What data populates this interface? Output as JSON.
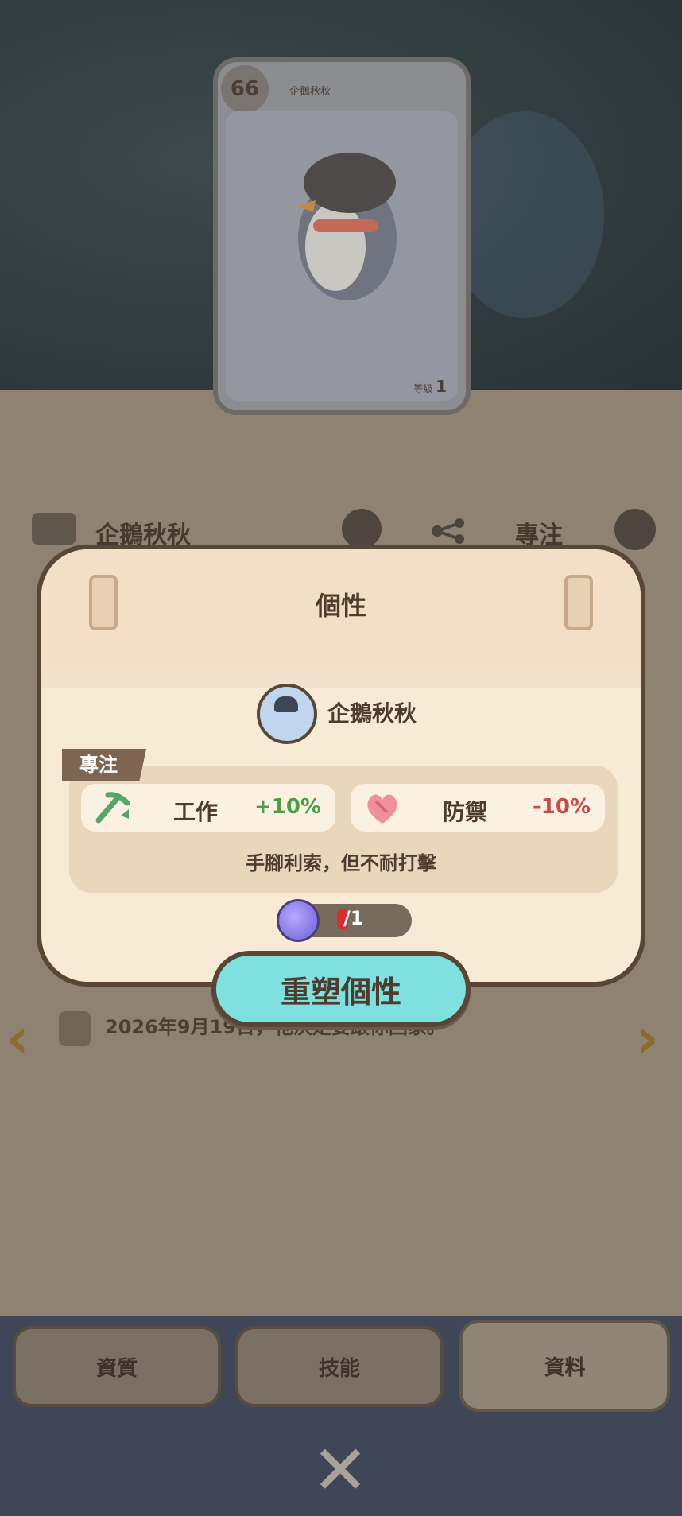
{
  "card": {
    "level_badge": "66",
    "name": "企鵝秋秋",
    "level_label": "等級",
    "level_value": "1"
  },
  "background_info": {
    "name": "企鵝秋秋",
    "focus_label": "專注",
    "note_text": "2026年9月19日，牠決定要跟你回家。"
  },
  "modal": {
    "title": "個性",
    "pet_name": "企鵝秋秋",
    "trait_tag": "專注",
    "stats": [
      {
        "label": "工作",
        "value": "+10%",
        "icon": "pickaxe-icon"
      },
      {
        "label": "防禦",
        "value": "-10%",
        "icon": "heart-shield-icon"
      }
    ],
    "description": "手腳利索，但不耐打擊",
    "counter": "/1",
    "reshape_button": "重塑個性"
  },
  "tabs": [
    {
      "label": "資質"
    },
    {
      "label": "技能"
    },
    {
      "label": "資料"
    }
  ],
  "colors": {
    "accent": "#7fe0e0",
    "positive": "#4c9d46",
    "negative": "#c84b4b"
  }
}
